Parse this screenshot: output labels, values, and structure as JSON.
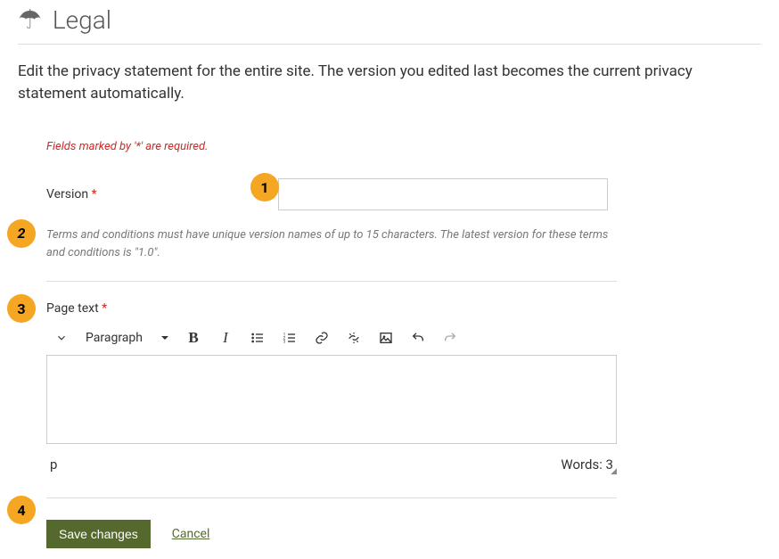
{
  "header": {
    "title": "Legal"
  },
  "intro": "Edit the privacy statement for the entire site. The version you edited last becomes the current privacy statement automatically.",
  "form": {
    "required_note": "Fields marked by '*' are required.",
    "version_label": "Version",
    "version_value": "",
    "version_help": "Terms and conditions must have unique version names of up to 15 characters. The latest version for these terms and conditions is \"1.0\".",
    "pagetext_label": "Page text",
    "toolbar": {
      "paragraph": "Paragraph"
    },
    "status": {
      "path": "p",
      "words": "Words: 3"
    },
    "save_label": "Save changes",
    "cancel_label": "Cancel"
  },
  "markers": {
    "m1": "1",
    "m2": "2",
    "m3": "3",
    "m4": "4"
  }
}
